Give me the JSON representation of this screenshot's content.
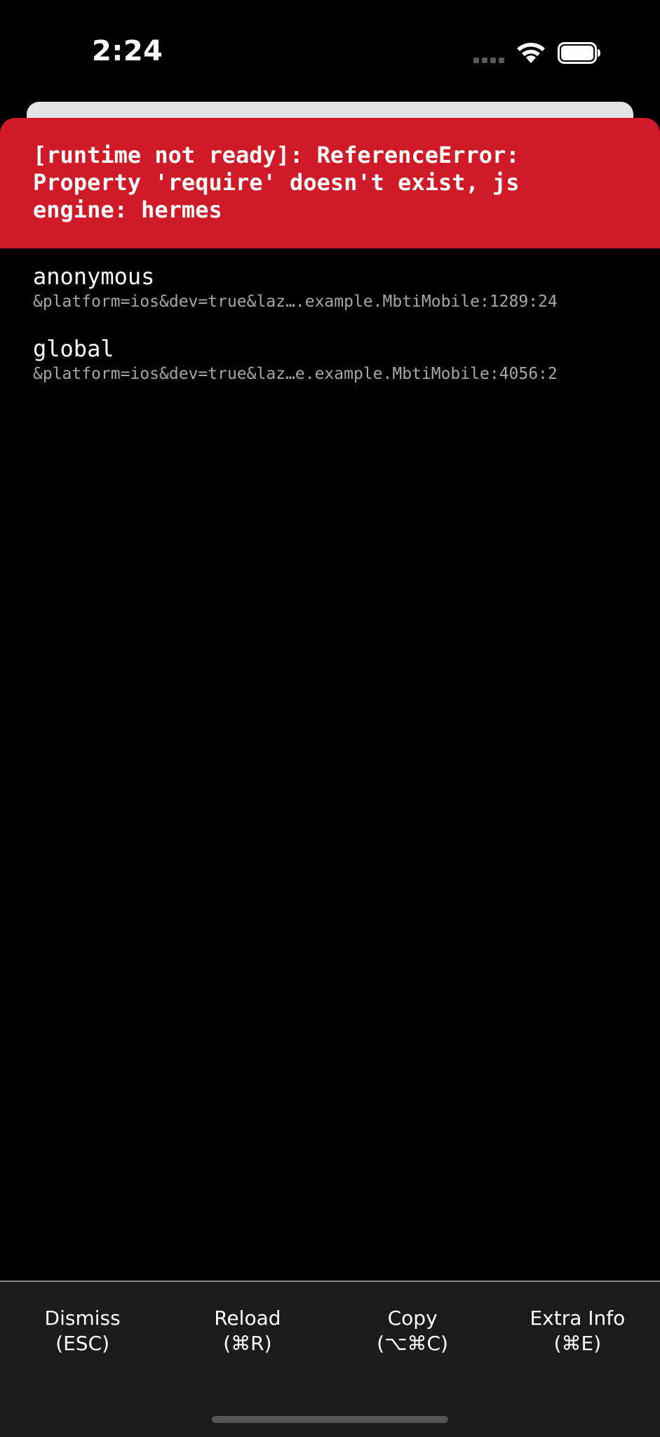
{
  "status_bar": {
    "time": "2:24",
    "icons": [
      "cellular-signal-icon",
      "wifi-icon",
      "battery-icon"
    ]
  },
  "error": {
    "message": "[runtime not ready]: ReferenceError: Property 'require' doesn't exist, js engine: hermes"
  },
  "stack": [
    {
      "method": "anonymous",
      "location": "&platform=ios&dev=true&laz….example.MbtiMobile:1289:24"
    },
    {
      "method": "global",
      "location": "&platform=ios&dev=true&laz…e.example.MbtiMobile:4056:2"
    }
  ],
  "footer": {
    "buttons": [
      {
        "label": "Dismiss",
        "shortcut": "(ESC)"
      },
      {
        "label": "Reload",
        "shortcut": "(⌘R)"
      },
      {
        "label": "Copy",
        "shortcut": "(⌥⌘C)"
      },
      {
        "label": "Extra Info",
        "shortcut": "(⌘E)"
      }
    ]
  },
  "colors": {
    "background": "#000000",
    "error_header": "#d11a27",
    "footer": "#1b1b1b",
    "stack_location": "#a6a6a6"
  }
}
